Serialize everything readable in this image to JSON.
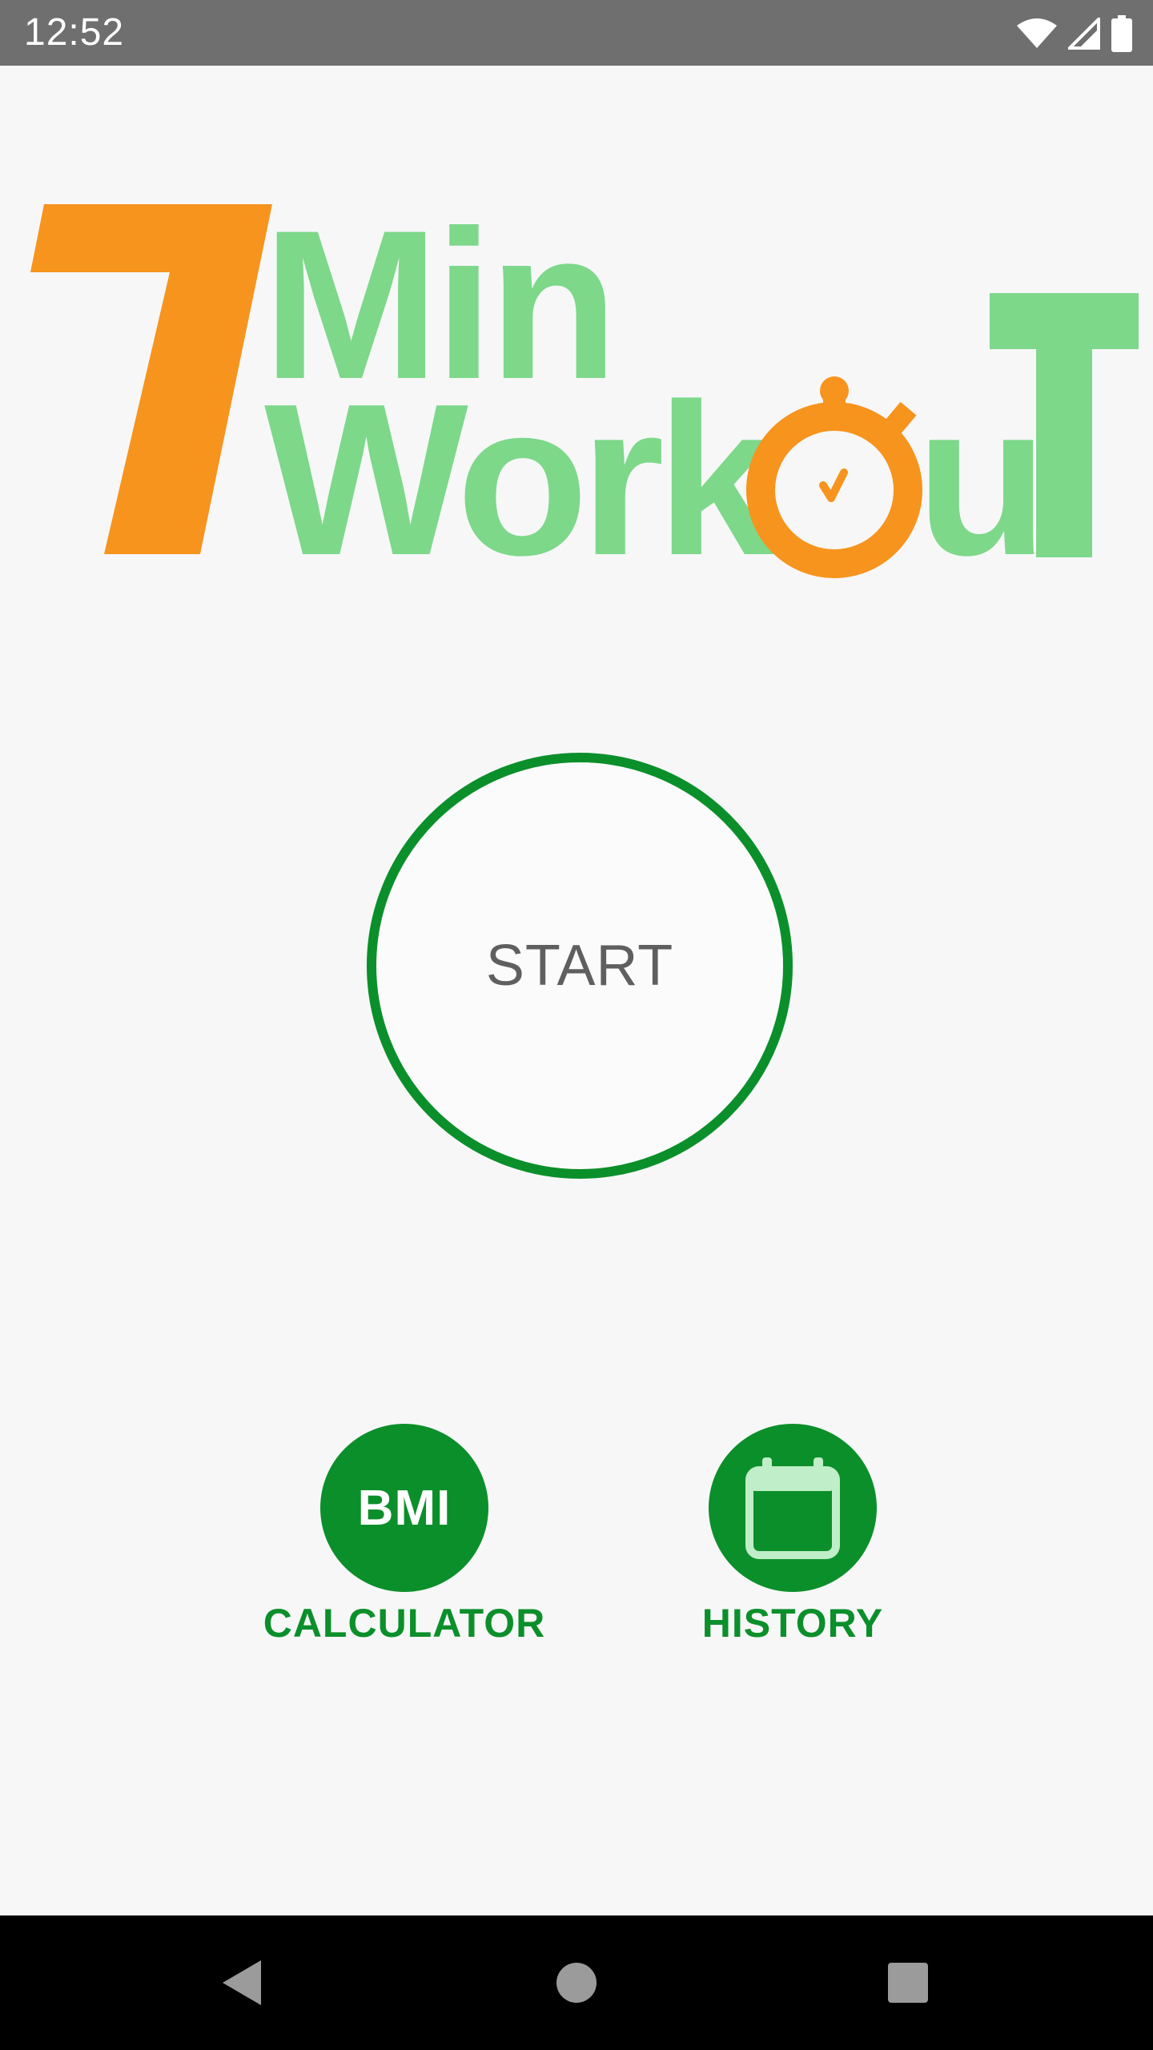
{
  "status_bar": {
    "time": "12:52",
    "icons": [
      "wifi-icon",
      "signal-icon",
      "battery-icon"
    ]
  },
  "logo": {
    "number": "7",
    "word1": "Min",
    "word2_prefix": "Work",
    "word2_suffix": "u",
    "word2_end": "T",
    "colors": {
      "orange": "#f7941d",
      "green": "#7dd88a"
    }
  },
  "start": {
    "label": "START"
  },
  "actions": {
    "bmi": {
      "icon_text": "BMI",
      "label": "CALCULATOR"
    },
    "history": {
      "icon": "calendar-icon",
      "label": "HISTORY"
    }
  },
  "nav": {
    "buttons": [
      "back-icon",
      "home-icon",
      "recents-icon"
    ]
  },
  "colors": {
    "primary_green": "#0b8f2a",
    "logo_green": "#7dd88a",
    "logo_orange": "#f7941d",
    "background": "#f7f7f8"
  }
}
